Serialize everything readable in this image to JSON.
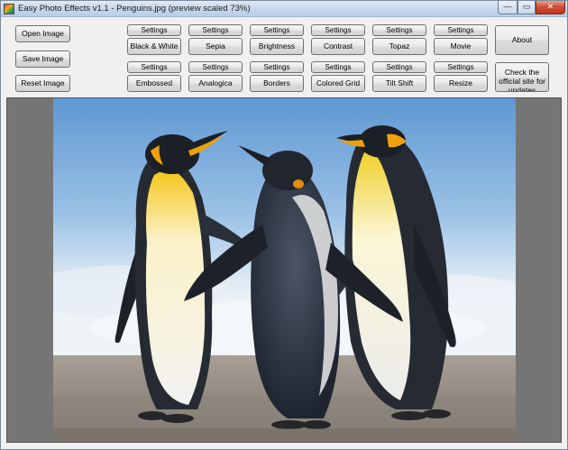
{
  "window": {
    "title": "Easy Photo Effects v1.1 - Penguins.jpg (preview scaled 73%)",
    "min_glyph": "—",
    "max_glyph": "▭",
    "close_glyph": "✕"
  },
  "file_buttons": {
    "open": "Open Image",
    "save": "Save Image",
    "reset": "Reset Image"
  },
  "effects_row1": [
    {
      "settings": "Settings",
      "label": "Black & White"
    },
    {
      "settings": "Settings",
      "label": "Sepia"
    },
    {
      "settings": "Settings",
      "label": "Brightness"
    },
    {
      "settings": "Settings",
      "label": "Contrast"
    },
    {
      "settings": "Settings",
      "label": "Topaz"
    },
    {
      "settings": "Settings",
      "label": "Movie"
    }
  ],
  "effects_row2": [
    {
      "settings": "Settings",
      "label": "Embossed"
    },
    {
      "settings": "Settings",
      "label": "Analogica"
    },
    {
      "settings": "Settings",
      "label": "Borders"
    },
    {
      "settings": "Settings",
      "label": "Colored Grid"
    },
    {
      "settings": "Settings",
      "label": "Tilt Shift"
    },
    {
      "settings": "Settings",
      "label": "Resize"
    }
  ],
  "side_buttons": {
    "about": "About",
    "official_site": "Check the official site for updates"
  },
  "colors": {
    "preview_background": "#757575",
    "sky_top": "#6ea3d8",
    "sand": "#9d968c"
  },
  "icons": {
    "app": "photo-effects-app-icon",
    "minimize": "minimize-icon",
    "maximize": "maximize-icon",
    "close": "close-icon"
  }
}
